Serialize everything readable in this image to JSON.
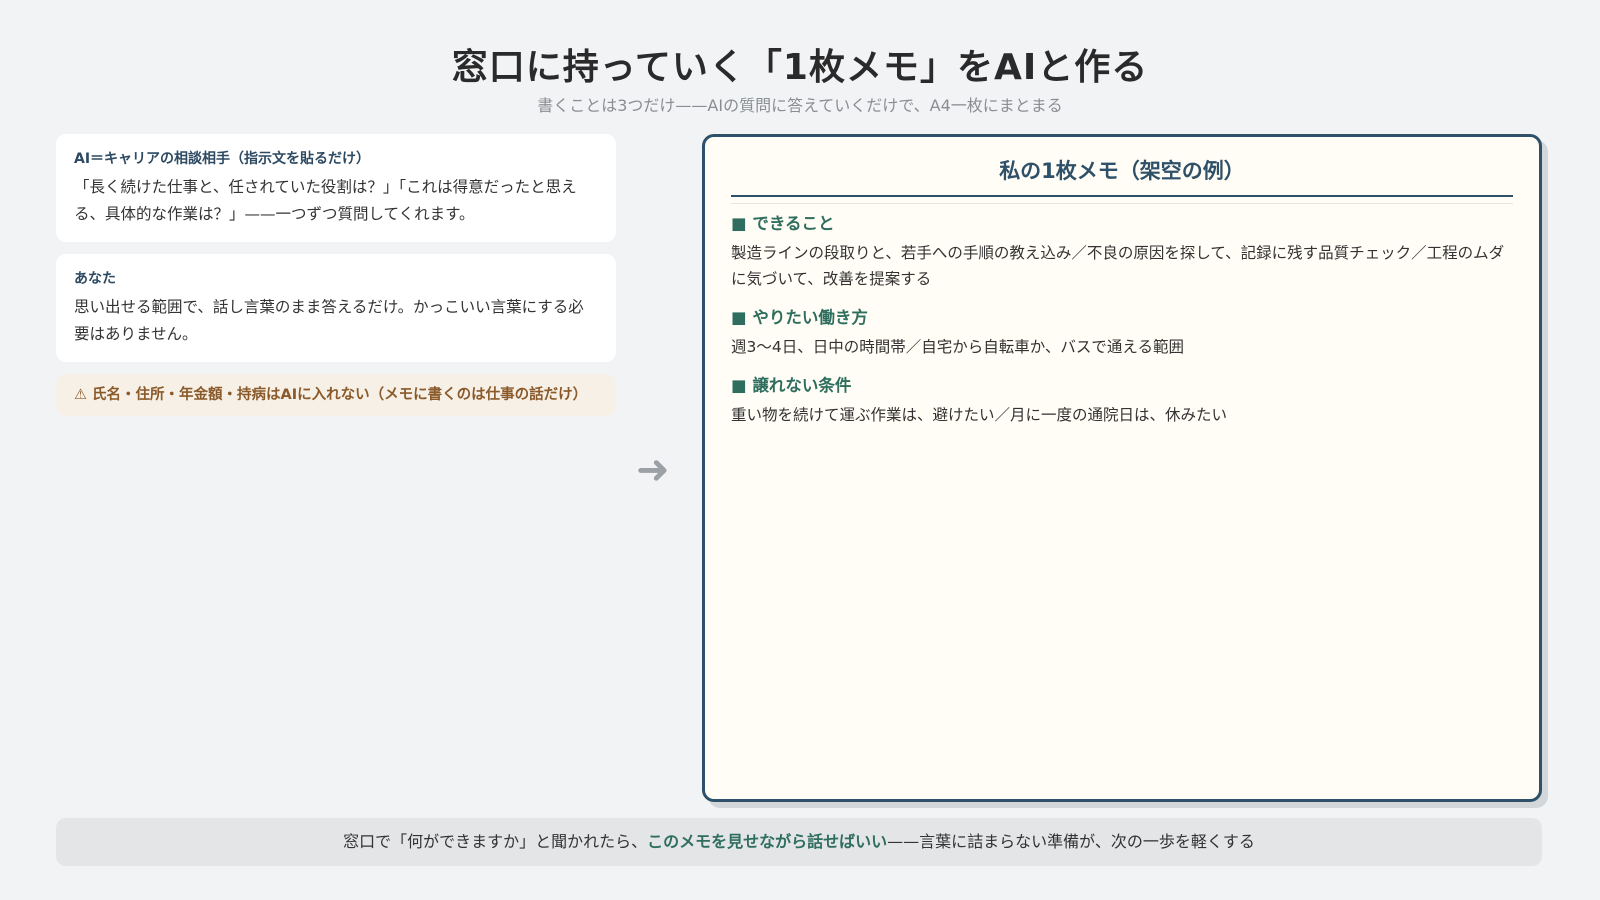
{
  "title": "窓口に持っていく「1枚メモ」をAIと作る",
  "subtitle": "書くことは3つだけ——AIの質問に答えていくだけで、A4一枚にまとまる",
  "cards": [
    {
      "label": "AI＝キャリアの相談相手（指示文を貼るだけ）",
      "body": "「長く続けた仕事と、任されていた役割は？」「これは得意だったと思える、具体的な作業は？」——一つずつ質問してくれます。"
    },
    {
      "label": "あなた",
      "body": "思い出せる範囲で、話し言葉のまま答えるだけ。かっこいい言葉にする必要はありません。"
    }
  ],
  "warning": "⚠ 氏名・住所・年金額・持病はAIに入れない（メモに書くのは仕事の話だけ）",
  "arrow": "➜",
  "memo": {
    "title": "私の1枚メモ（架空の例）",
    "sections": [
      {
        "heading": "■ できること",
        "body": "製造ラインの段取りと、若手への手順の教え込み／不良の原因を探して、記録に残す品質チェック／工程のムダに気づいて、改善を提案する"
      },
      {
        "heading": "■ やりたい働き方",
        "body": "週3〜4日、日中の時間帯／自宅から自転車か、バスで通える範囲"
      },
      {
        "heading": "■ 譲れない条件",
        "body": "重い物を続けて運ぶ作業は、避けたい／月に一度の通院日は、休みたい"
      }
    ]
  },
  "footer": {
    "before": "窓口で「何ができますか」と聞かれたら、",
    "highlight": "このメモを見せながら話せばいい",
    "after": "——言葉に詰まらない準備が、次の一歩を軽くする"
  },
  "colors": {
    "background": "#f2f3f5",
    "accent_navy": "#2e5068",
    "accent_green": "#2f6e5e",
    "warning_bg": "#f7f0e6",
    "warning_text": "#8a5a2a"
  }
}
